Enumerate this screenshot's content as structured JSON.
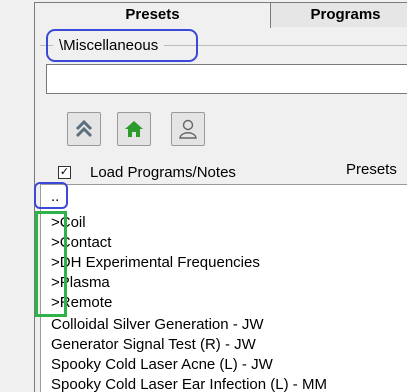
{
  "tabs": [
    {
      "label": "Presets"
    },
    {
      "label": "Programs"
    }
  ],
  "folder_path": "\\Miscellaneous",
  "search": {
    "value": ""
  },
  "toolbar": {
    "up_icon": "double-chevron-up-icon",
    "home_icon": "home-icon",
    "user_icon": "user-icon"
  },
  "load_programs": {
    "checked": true,
    "label": "Load Programs/Notes"
  },
  "presets_label": "Presets",
  "list": {
    "items": [
      {
        "label": ".."
      },
      {
        "label": ">Coil"
      },
      {
        "label": ">Contact"
      },
      {
        "label": ">DH Experimental Frequencies"
      },
      {
        "label": ">Plasma"
      },
      {
        "label": ">Remote"
      },
      {
        "label": "Colloidal Silver Generation - JW"
      },
      {
        "label": "Generator Signal Test (R) - JW"
      },
      {
        "label": "Spooky Cold Laser Acne (L) - JW"
      },
      {
        "label": "Spooky Cold Laser Ear Infection (L) - MM"
      }
    ]
  },
  "colors": {
    "highlight_blue": "#3b49d6",
    "highlight_green": "#2eb24a",
    "home_green": "#2c9a2c"
  }
}
